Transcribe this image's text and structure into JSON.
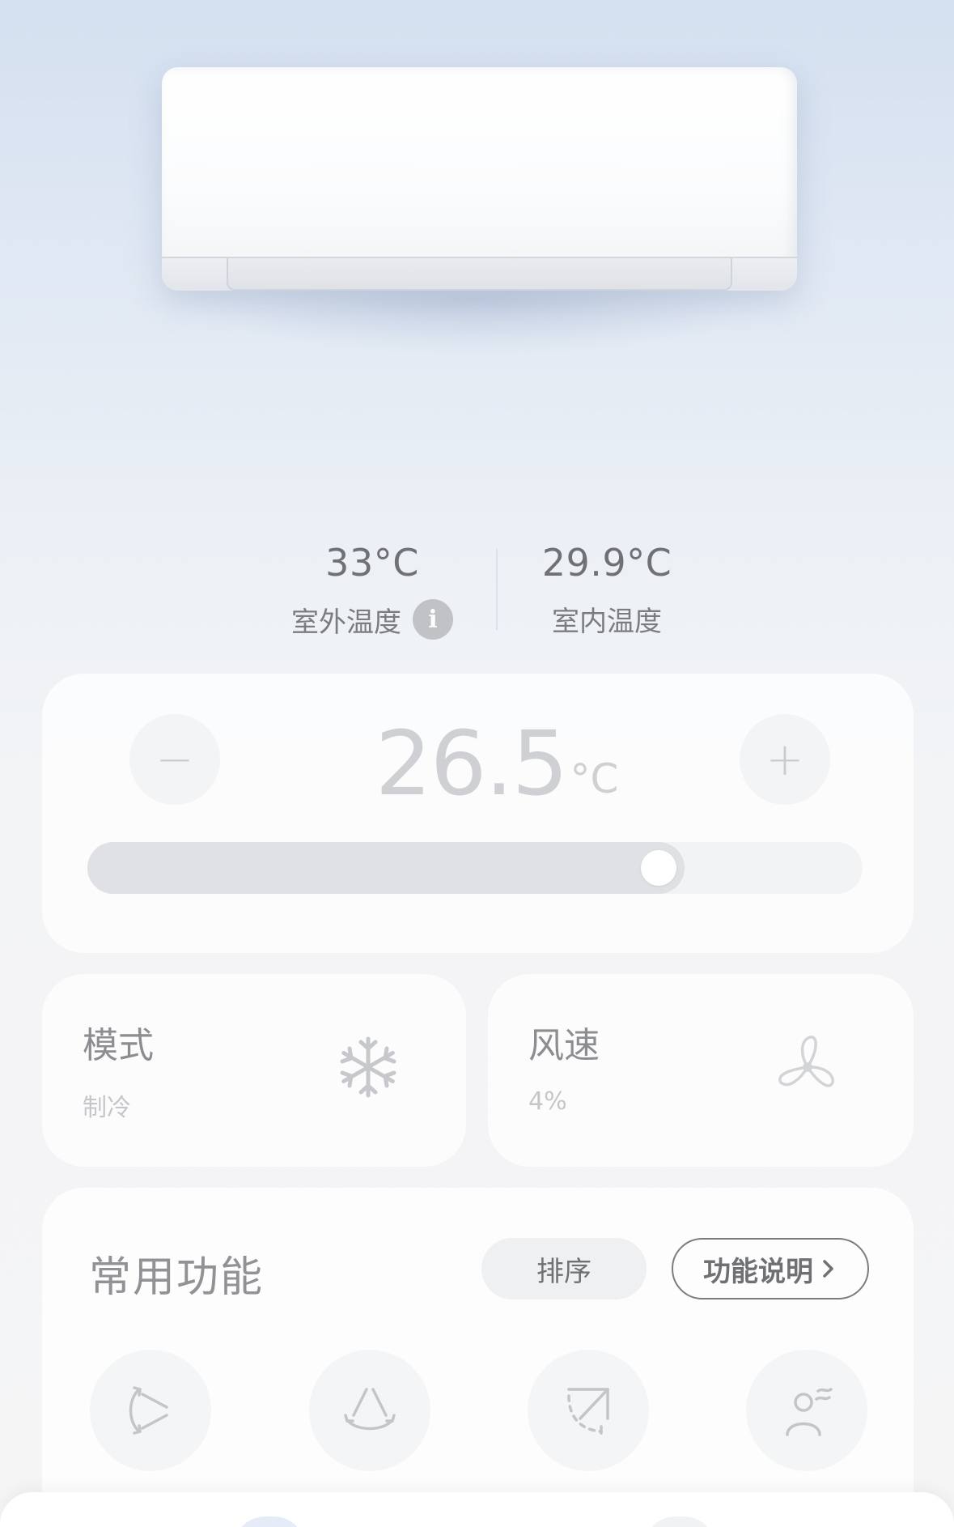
{
  "outdoor": {
    "value": "33°C",
    "label": "室外温度"
  },
  "indoor": {
    "value": "29.9°C",
    "label": "室内温度"
  },
  "setpoint": {
    "value": "26.5",
    "unit": "°C",
    "minus_label": "−",
    "plus_label": "+",
    "slider_fraction": 0.77
  },
  "mode": {
    "title": "模式",
    "value": "制冷",
    "icon": "snowflake-icon"
  },
  "fan": {
    "title": "风速",
    "value": "4%",
    "icon": "fan-icon"
  },
  "features": {
    "title": "常用功能",
    "sort_label": "排序",
    "help_label": "功能说明",
    "items": [
      {
        "icon": "swing-vertical-icon"
      },
      {
        "icon": "swing-horizontal-icon"
      },
      {
        "icon": "wind-direction-icon"
      },
      {
        "icon": "wind-avoid-person-icon"
      }
    ]
  }
}
